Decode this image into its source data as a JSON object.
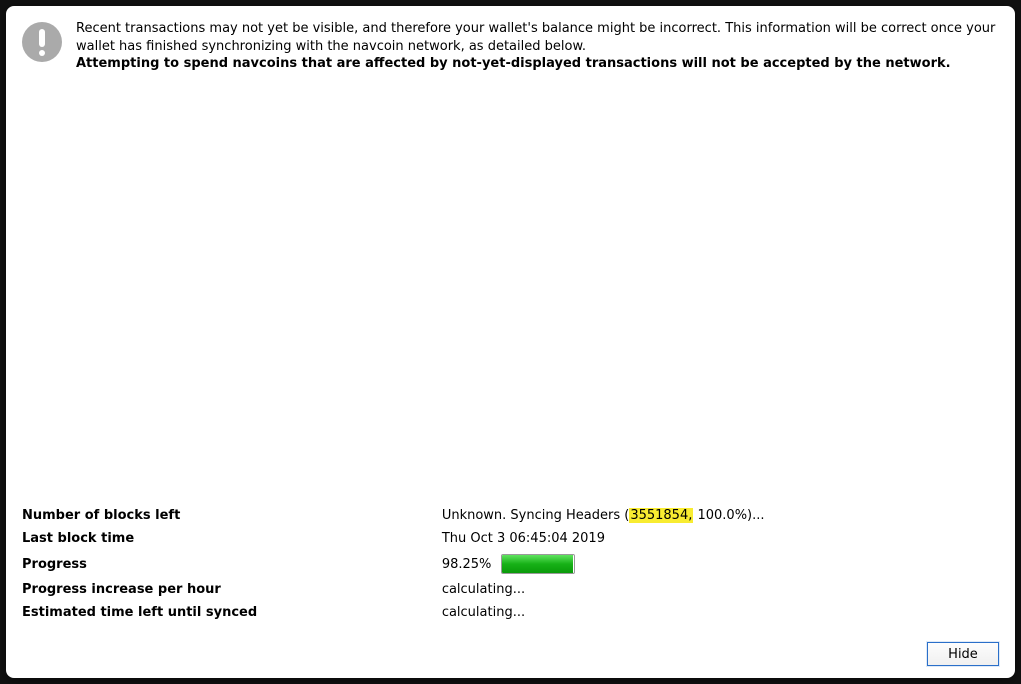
{
  "message": {
    "line1": "Recent transactions may not yet be visible, and therefore your wallet's balance might be incorrect. This information will be correct once your wallet has finished synchronizing with the navcoin network, as detailed below.",
    "line2": "Attempting to spend navcoins that are affected by not-yet-displayed transactions will not be accepted by the network."
  },
  "rows": {
    "blocks_left_label": "Number of blocks left",
    "blocks_left_prefix": "Unknown. Syncing Headers (",
    "blocks_left_highlight": "3551854,",
    "blocks_left_suffix": " 100.0%)...",
    "last_block_label": "Last block time",
    "last_block_value": "Thu Oct 3 06:45:04 2019",
    "progress_label": "Progress",
    "progress_value": "98.25%",
    "progress_fill_percent": 98.25,
    "incr_label": "Progress increase per hour",
    "incr_value": "calculating...",
    "eta_label": "Estimated time left until synced",
    "eta_value": "calculating..."
  },
  "buttons": {
    "hide": "Hide"
  }
}
